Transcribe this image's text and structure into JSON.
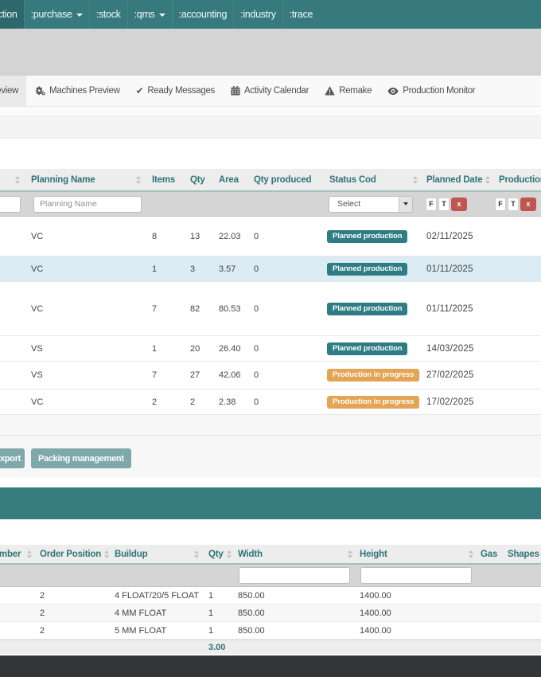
{
  "colors": {
    "navbar_teal": "#377a7e",
    "navbar_active_teal": "#2d686c",
    "header_text_teal": "#2f7477",
    "badge_planned_teal": "#2e7d84",
    "badge_progress_orange": "#e3a455",
    "action_button_teal": "#7fa8ab",
    "panel_band_teal": "#377c7f",
    "clear_button_red": "#bf5750",
    "selected_row_blue": "#dbecf4",
    "footer_dark": "#333639"
  },
  "navbar": {
    "items": [
      {
        "label": ":production",
        "active": true,
        "caret": false
      },
      {
        "label": ":purchase",
        "active": false,
        "caret": true
      },
      {
        "label": ":stock",
        "active": false,
        "caret": false
      },
      {
        "label": ":qms",
        "active": false,
        "caret": true
      },
      {
        "label": ":accounting",
        "active": false,
        "caret": false
      },
      {
        "label": ":industry",
        "active": false,
        "caret": false
      },
      {
        "label": ":trace",
        "active": false,
        "caret": false
      }
    ]
  },
  "tabs": {
    "items": [
      {
        "label": "Planning Preview",
        "icon": "list",
        "active": true
      },
      {
        "label": "Machines Preview",
        "icon": "cogs",
        "active": false
      },
      {
        "label": "Ready Messages",
        "icon": "check",
        "active": false
      },
      {
        "label": "Activity Calendar",
        "icon": "calendar",
        "active": false
      },
      {
        "label": "Remake",
        "icon": "warning",
        "active": false
      },
      {
        "label": "Production Monitor",
        "icon": "eye",
        "active": false
      }
    ]
  },
  "planning_table": {
    "columns": {
      "planning_name": "Planning Name",
      "items": "Items",
      "qty": "Qty",
      "area": "Area",
      "qty_produced": "Qty produced",
      "status_cod": "Status Cod",
      "planned_date": "Planned Date",
      "production": "Production"
    },
    "filters": {
      "planning_name_placeholder": "Planning Name",
      "status_select_value": "Select",
      "date_from_label": "F",
      "date_to_label": "T",
      "clear_label": "x"
    },
    "rows": [
      {
        "planning_name": "VC",
        "items": "8",
        "qty": "13",
        "area": "22.03",
        "qty_produced": "0",
        "status": "Planned production",
        "status_type": "planned",
        "planned_date": "02/11/2025",
        "selected": false
      },
      {
        "planning_name": "VC",
        "items": "1",
        "qty": "3",
        "area": "3.57",
        "qty_produced": "0",
        "status": "Planned production",
        "status_type": "planned",
        "planned_date": "01/11/2025",
        "selected": true
      },
      {
        "planning_name": "VC",
        "items": "7",
        "qty": "82",
        "area": "80.53",
        "qty_produced": "0",
        "status": "Planned production",
        "status_type": "planned",
        "planned_date": "01/11/2025",
        "selected": false
      },
      {
        "planning_name": "VS",
        "items": "1",
        "qty": "20",
        "area": "26.40",
        "qty_produced": "0",
        "status": "Planned production",
        "status_type": "planned",
        "planned_date": "14/03/2025",
        "selected": false
      },
      {
        "planning_name": "VS",
        "items": "7",
        "qty": "27",
        "area": "42.06",
        "qty_produced": "0",
        "status": "Production in progress",
        "status_type": "progress",
        "planned_date": "27/02/2025",
        "selected": false
      },
      {
        "planning_name": "VC",
        "items": "2",
        "qty": "2",
        "area": "2.38",
        "qty_produced": "0",
        "status": "Production in progress",
        "status_type": "progress",
        "planned_date": "17/02/2025",
        "selected": false
      }
    ]
  },
  "actions": {
    "export_label": "Export",
    "packing_label": "Packing management"
  },
  "positions_table": {
    "columns": {
      "number": "Number",
      "order_position": "Order Position",
      "buildup": "Buildup",
      "qty": "Qty",
      "width": "Width",
      "height": "Height",
      "gas": "Gas",
      "shapes": "Shapes"
    },
    "rows": [
      {
        "order_position": "2",
        "buildup": "4 FLOAT/20/5 FLOAT",
        "qty": "1",
        "width": "850.00",
        "height": "1400.00"
      },
      {
        "order_position": "2",
        "buildup": "4 MM FLOAT",
        "qty": "1",
        "width": "850.00",
        "height": "1400.00"
      },
      {
        "order_position": "2",
        "buildup": "5 MM FLOAT",
        "qty": "1",
        "width": "850.00",
        "height": "1400.00"
      }
    ],
    "qty_total": "3.00"
  }
}
